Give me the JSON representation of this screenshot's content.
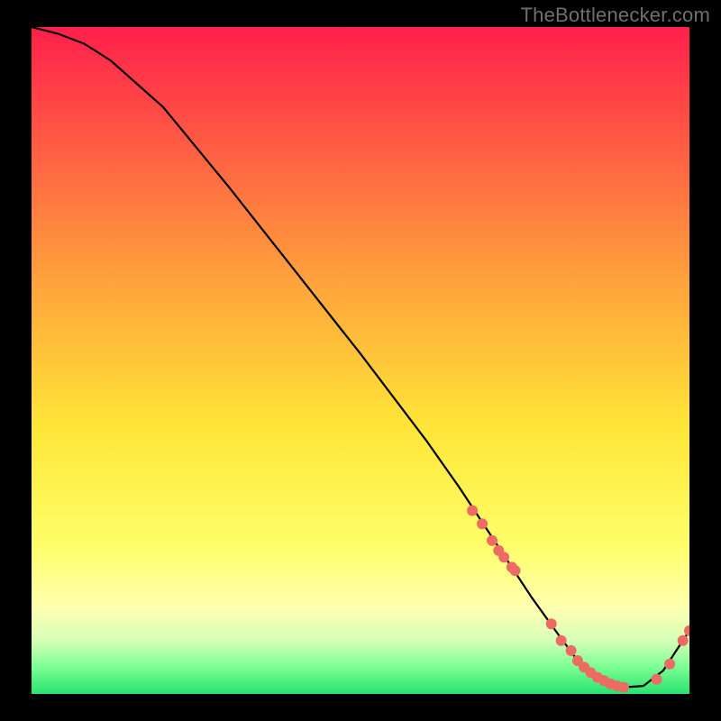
{
  "watermark": "TheBottlenecker.com",
  "colors": {
    "top": "#ff1f4b",
    "mid_upper": "#ffa23c",
    "mid": "#ffe637",
    "mid_lower": "#fdff6a",
    "pale_yellow": "#ffffb0",
    "pale_green": "#d6ffb8",
    "green_light": "#7bff92",
    "green": "#27e36f",
    "curve": "#000000",
    "marker": "#ec6b63",
    "frame_bg": "#000000"
  },
  "chart_data": {
    "type": "line",
    "title": "",
    "xlabel": "",
    "ylabel": "",
    "xlim": [
      0,
      100
    ],
    "ylim": [
      0,
      100
    ],
    "curve": {
      "x": [
        0,
        4,
        8,
        12,
        20,
        30,
        40,
        50,
        60,
        65,
        68,
        72,
        76,
        80,
        83,
        86,
        88,
        90,
        93,
        96,
        98,
        100
      ],
      "y": [
        100,
        99,
        97.5,
        95,
        88,
        76,
        63.5,
        51,
        38,
        31,
        26.5,
        20.5,
        14.5,
        9,
        5,
        2.5,
        1.5,
        1,
        1.2,
        3.5,
        6.5,
        9.5
      ]
    },
    "markers": {
      "x": [
        67,
        68.5,
        70,
        71,
        71.8,
        73,
        73.5,
        79,
        80.5,
        82,
        83,
        84,
        85,
        86,
        87,
        88,
        89,
        90,
        95,
        97,
        99,
        100
      ],
      "y": [
        27.5,
        25.5,
        23,
        21.5,
        20.5,
        19,
        18.5,
        10.5,
        8,
        6.5,
        5,
        4,
        3.2,
        2.5,
        2,
        1.5,
        1.2,
        1,
        2.2,
        4.5,
        8,
        9.5
      ]
    }
  }
}
